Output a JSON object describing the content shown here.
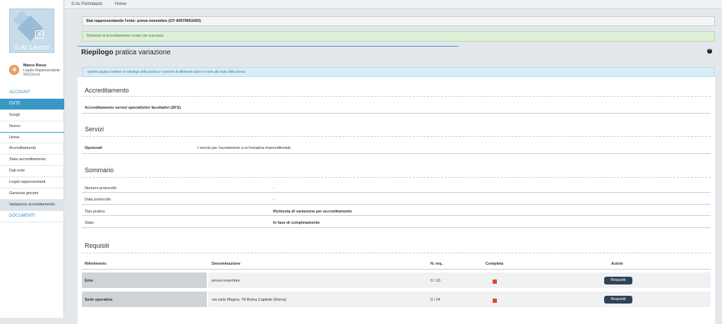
{
  "topnav": {
    "brand": "S.Ac Formalazio",
    "home": "Home"
  },
  "logo": {
    "text": "S.Ac Lavoro"
  },
  "user": {
    "name": "Marco Rossi",
    "role": "Legale Rappresentante 93211cco1"
  },
  "menu": {
    "account": "ACCOUNT",
    "ente": "ENTE",
    "scegli": "Scegli",
    "nuovo": "Nuovo",
    "home": "Home",
    "accreditamento": "Accreditamento",
    "stato_accreditamento": "Stato accreditamento",
    "dati_ente": "Dati ente",
    "legali": "Legali rappresentanti",
    "garanzia": "Garanzia giovani",
    "variazione": "Variazione accreditamento",
    "documenti": "DOCUMENTI"
  },
  "alerts": {
    "representing": "Stai rappresentando l'ente: prova novembre (CF 00579951003)",
    "success": "Richiesta di accreditamento creata con successo"
  },
  "page": {
    "title_bold": "Riepilogo",
    "title_rest": " pratica variazione",
    "help": "?",
    "info": "Questa pagina contiene un riepilogo della pratica e consente di effettuare azioni in base allo stato della stessa"
  },
  "accreditamento": {
    "heading": "Accreditamento",
    "value": "Accreditamento servizi specialistici facoltativi (SFS)"
  },
  "servizi": {
    "heading": "Servizi",
    "label": "Opzionali",
    "value": "I servizi per l'avviamento a un'iniziativa imprenditoriale"
  },
  "sommario": {
    "heading": "Sommario",
    "rows": [
      {
        "label": "Numero protocollo",
        "value": "-"
      },
      {
        "label": "Data protocollo",
        "value": "-"
      },
      {
        "label": "Tipo pratica",
        "value": "Richiesta di variazione per accreditamento"
      },
      {
        "label": "Stato",
        "value": "In fase di completamento"
      }
    ]
  },
  "requisiti": {
    "heading": "Requisiti",
    "columns": [
      "Riferimento",
      "Denominazione",
      "N. req.",
      "Completa",
      "Azioni"
    ],
    "rows": [
      {
        "riferimento": "Ente",
        "denominazione": "prova novembre",
        "nreq": "0 / 10",
        "completa_color": "#d84a2b",
        "azione": "Requisiti"
      },
      {
        "riferimento": "Sede operativa",
        "denominazione": "via carlo Magno, 78 Roma Capitale (Roma)",
        "nreq": "0 / 24",
        "completa_color": "#d84a2b",
        "azione": "Requisiti"
      }
    ]
  }
}
